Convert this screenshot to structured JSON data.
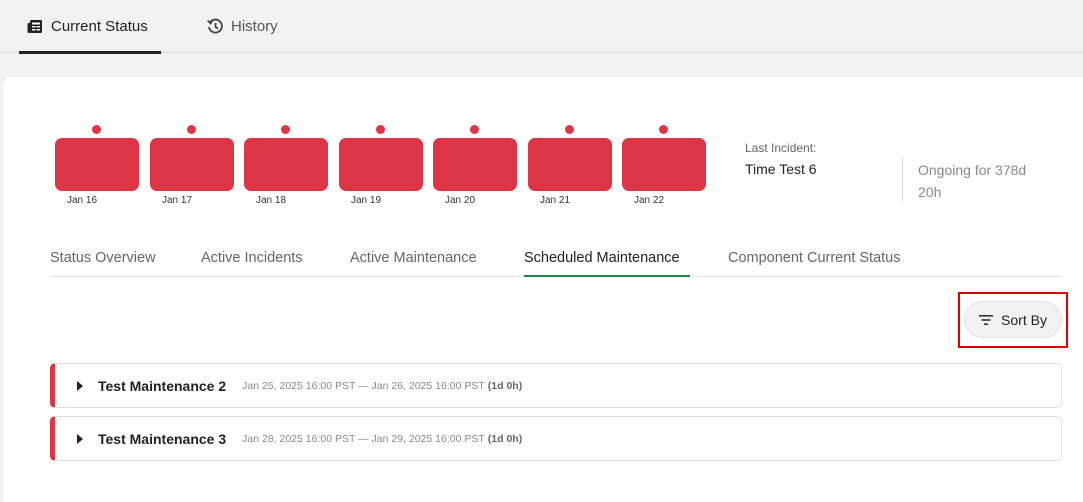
{
  "top_tabs": [
    {
      "label": "Current Status",
      "icon": "newspaper-icon"
    },
    {
      "label": "History",
      "icon": "history-icon"
    }
  ],
  "timeline": {
    "status_color": "#dc3545",
    "days": [
      {
        "date": "Jan 16"
      },
      {
        "date": "Jan 17"
      },
      {
        "date": "Jan 18"
      },
      {
        "date": "Jan 19"
      },
      {
        "date": "Jan 20"
      },
      {
        "date": "Jan 21"
      },
      {
        "date": "Jan 22"
      }
    ]
  },
  "last_incident": {
    "label": "Last Incident:",
    "name": "Time Test 6",
    "ongoing": "Ongoing for 378d 20h"
  },
  "sub_tabs": [
    {
      "label": "Status Overview"
    },
    {
      "label": "Active Incidents"
    },
    {
      "label": "Active Maintenance"
    },
    {
      "label": "Scheduled Maintenance",
      "active": true
    },
    {
      "label": "Component Current Status"
    }
  ],
  "sort": {
    "label": "Sort By",
    "icon": "filter-lines-icon"
  },
  "maintenance": [
    {
      "title": "Test Maintenance 2",
      "range": "Jan 25, 2025 16:00 PST — Jan 26, 2025 16:00 PST",
      "duration": "(1d 0h)"
    },
    {
      "title": "Test Maintenance 3",
      "range": "Jan 28, 2025 16:00 PST — Jan 29, 2025 16:00 PST",
      "duration": "(1d 0h)"
    }
  ],
  "accent": {
    "active_tab_underline": "#1f8a4c",
    "incident_red": "#dc3545"
  }
}
